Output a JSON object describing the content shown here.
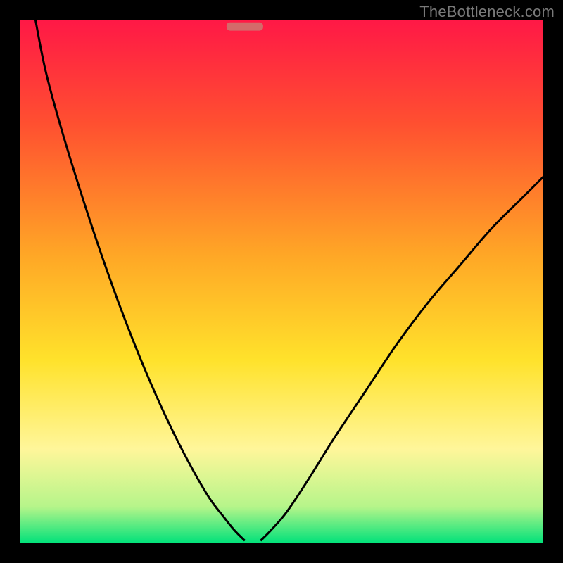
{
  "watermark": "TheBottleneck.com",
  "chart_data": {
    "type": "line",
    "title": "",
    "xlabel": "",
    "ylabel": "",
    "xlim": [
      0,
      100
    ],
    "ylim": [
      0,
      100
    ],
    "background_gradient": {
      "stops": [
        {
          "offset": 0.0,
          "color": "#ff1846"
        },
        {
          "offset": 0.2,
          "color": "#ff5030"
        },
        {
          "offset": 0.45,
          "color": "#ffa726"
        },
        {
          "offset": 0.65,
          "color": "#ffe22b"
        },
        {
          "offset": 0.82,
          "color": "#fff69a"
        },
        {
          "offset": 0.93,
          "color": "#b6f58a"
        },
        {
          "offset": 1.0,
          "color": "#00e17a"
        }
      ]
    },
    "marker": {
      "x": 43,
      "y": 98.7,
      "width": 7,
      "height": 1.6,
      "color": "#d36a6a"
    },
    "series": [
      {
        "name": "left-curve",
        "x": [
          3,
          5,
          8,
          12,
          16,
          20,
          24,
          28,
          32,
          36,
          39,
          41,
          43
        ],
        "values": [
          100,
          90,
          79,
          66,
          54,
          43,
          33,
          24,
          16,
          9,
          5,
          2.5,
          0.5
        ]
      },
      {
        "name": "right-curve",
        "x": [
          46,
          48,
          51,
          55,
          60,
          66,
          72,
          78,
          84,
          90,
          96,
          100
        ],
        "values": [
          0.5,
          2.5,
          6,
          12,
          20,
          29,
          38,
          46,
          53,
          60,
          66,
          70
        ]
      }
    ]
  }
}
